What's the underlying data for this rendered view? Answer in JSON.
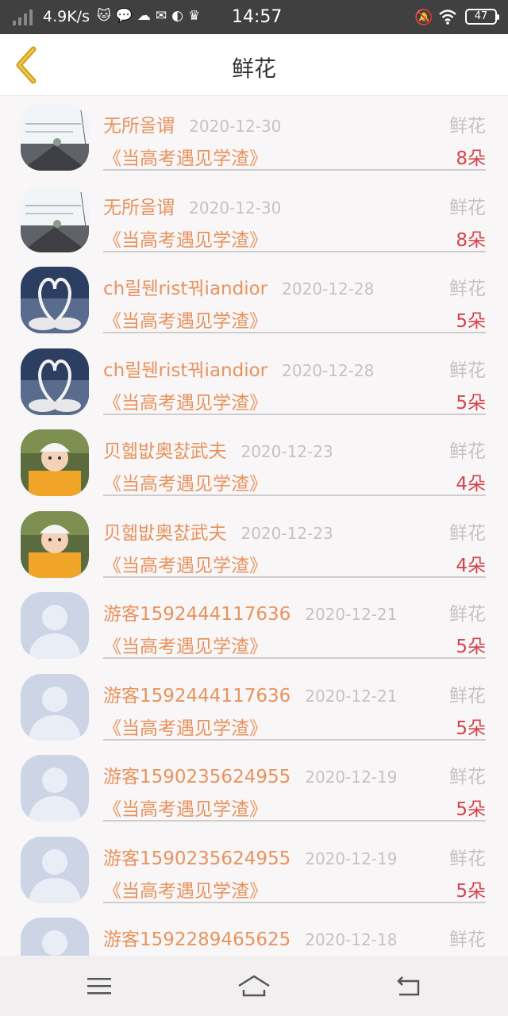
{
  "status_bar": {
    "network_speed": "4.9K/s",
    "time": "14:57",
    "battery": "47",
    "app_icons": "🐱💬☁✉◐♛"
  },
  "header": {
    "title": "鲜花"
  },
  "items": [
    {
      "name": "无所올谓",
      "date": "2020-12-30",
      "gift": "鲜花",
      "book": "《当高考遇见学渣》",
      "count": "8朵",
      "avatar": "landscape"
    },
    {
      "name": "无所올谓",
      "date": "2020-12-30",
      "gift": "鲜花",
      "book": "《当高考遇见学渣》",
      "count": "8朵",
      "avatar": "landscape"
    },
    {
      "name": "ch릴뒌rist꿔iandior",
      "date": "2020-12-28",
      "gift": "鲜花",
      "book": "《当高考遇见学渣》",
      "count": "5朵",
      "avatar": "swans"
    },
    {
      "name": "ch릴뒌rist꿔iandior",
      "date": "2020-12-28",
      "gift": "鲜花",
      "book": "《当高考遇见学渣》",
      "count": "5朵",
      "avatar": "swans"
    },
    {
      "name": "贝헯밦奥챬武夫",
      "date": "2020-12-23",
      "gift": "鲜花",
      "book": "《当高考遇见学渣》",
      "count": "4朵",
      "avatar": "child"
    },
    {
      "name": "贝헯밦奥챬武夫",
      "date": "2020-12-23",
      "gift": "鲜花",
      "book": "《当高考遇见学渣》",
      "count": "4朵",
      "avatar": "child"
    },
    {
      "name": "游客1592444117636",
      "date": "2020-12-21",
      "gift": "鲜花",
      "book": "《当高考遇见学渣》",
      "count": "5朵",
      "avatar": "default"
    },
    {
      "name": "游客1592444117636",
      "date": "2020-12-21",
      "gift": "鲜花",
      "book": "《当高考遇见学渣》",
      "count": "5朵",
      "avatar": "default"
    },
    {
      "name": "游客1590235624955",
      "date": "2020-12-19",
      "gift": "鲜花",
      "book": "《当高考遇见学渣》",
      "count": "5朵",
      "avatar": "default"
    },
    {
      "name": "游客1590235624955",
      "date": "2020-12-19",
      "gift": "鲜花",
      "book": "《当高考遇见学渣》",
      "count": "5朵",
      "avatar": "default"
    },
    {
      "name": "游客1592289465625",
      "date": "2020-12-18",
      "gift": "鲜花",
      "book": "",
      "count": "",
      "avatar": "default"
    }
  ],
  "icons": {
    "back": "chevron-left-icon",
    "menu": "menu-icon",
    "home": "home-icon",
    "return": "return-icon"
  },
  "colors": {
    "accent": "#e8935e",
    "count": "#d4434d",
    "muted": "#c5c2c4",
    "back_icon": "#d6a51c"
  }
}
